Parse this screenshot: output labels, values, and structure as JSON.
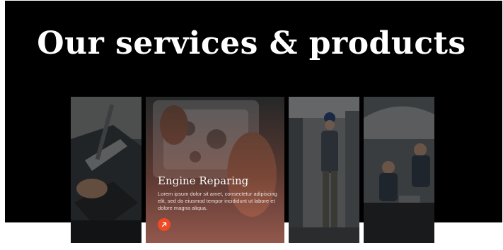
{
  "section": {
    "title": "Our services & products"
  },
  "cards": [
    {
      "name": "engine-bay-tools"
    },
    {
      "name": "engine-repairing",
      "title": "Engine Reparing",
      "description": "Lorem ipsum dolor sit amet, consectetur adipiscing elit, sed do eiusmod tempor incididunt ut labore et dolore magna aliqua.",
      "button_icon": "arrow-up-right-icon"
    },
    {
      "name": "mechanic-in-garage"
    },
    {
      "name": "mechanics-under-hood"
    }
  ],
  "colors": {
    "hero_background": "#000000",
    "accent": "#ef4a24",
    "page_background": "#ffffff"
  }
}
